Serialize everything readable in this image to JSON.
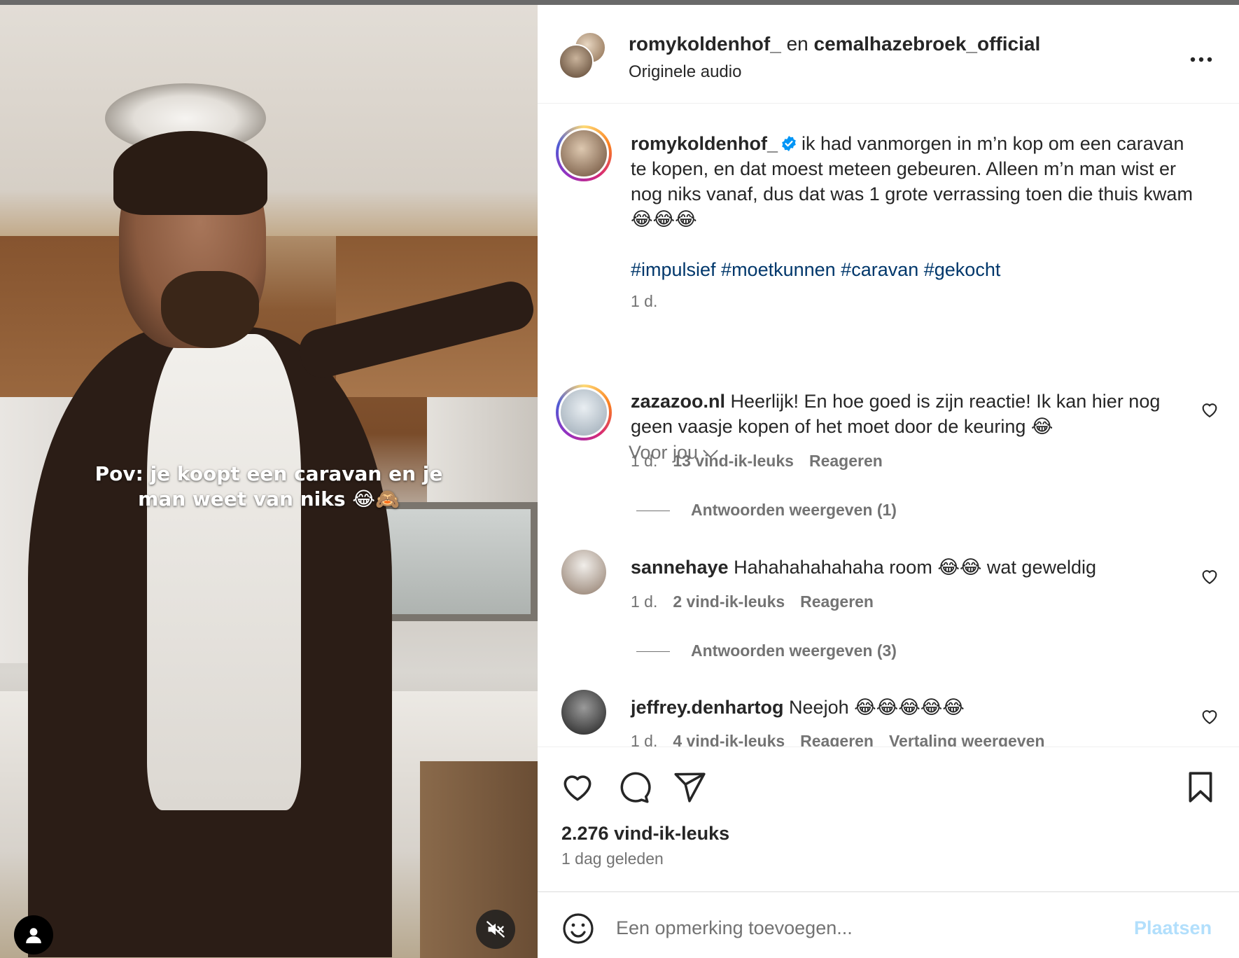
{
  "video": {
    "caption_line1": "Pov: je koopt een caravan en je",
    "caption_line2": "man weet van niks 😂🙈",
    "user_icon": "user-icon",
    "mute_icon": "speaker-muted-icon"
  },
  "header": {
    "user1": "romykoldenhof_",
    "connector": "en",
    "user2": "cemalhazebroek_official",
    "audio": "Originele audio",
    "more_icon": "more-horizontal-icon"
  },
  "caption": {
    "username": "romykoldenhof_",
    "text": "ik had vanmorgen in m’n kop om een caravan te kopen, en dat moest meteen gebeuren. Alleen m’n man wist er nog niks vanaf, dus dat was 1 grote verrassing toen die thuis kwam 😂😂😂",
    "hashtags": "#impulsief #moetkunnen #caravan #gekocht",
    "time": "1 d."
  },
  "voor_jou": "Voor jou",
  "comments": [
    {
      "username": "zazazoo.nl",
      "text": "Heerlijk! En hoe goed is zijn reactie! Ik kan hier nog geen vaasje kopen of het moet door de keuring 😂",
      "time": "1 d.",
      "likes": "13 vind-ik-leuks",
      "reply": "Reageren",
      "view_replies": "Antwoorden weergeven (1)"
    },
    {
      "username": "sannehaye",
      "text": "Hahahahahahaha room 😂😂 wat geweldig",
      "time": "1 d.",
      "likes": "2 vind-ik-leuks",
      "reply": "Reageren",
      "view_replies": "Antwoorden weergeven (3)"
    },
    {
      "username": "jeffrey.denhartog",
      "text": "Neejoh 😂😂😂😂😂",
      "time": "1 d.",
      "likes": "4 vind-ik-leuks",
      "reply": "Reageren",
      "translate": "Vertaling weergeven"
    }
  ],
  "actions": {
    "like_icon": "heart-icon",
    "comment_icon": "comment-icon",
    "share_icon": "send-icon",
    "save_icon": "bookmark-icon",
    "likes": "2.276 vind-ik-leuks",
    "ago": "1 dag geleden"
  },
  "add_comment": {
    "placeholder": "Een opmerking toevoegen...",
    "post_label": "Plaatsen",
    "emoji_icon": "emoji-icon"
  },
  "colors": {
    "link": "#00376b",
    "secondary_text": "#737373",
    "verified": "#0095f6",
    "post_disabled": "#b2dffc"
  }
}
